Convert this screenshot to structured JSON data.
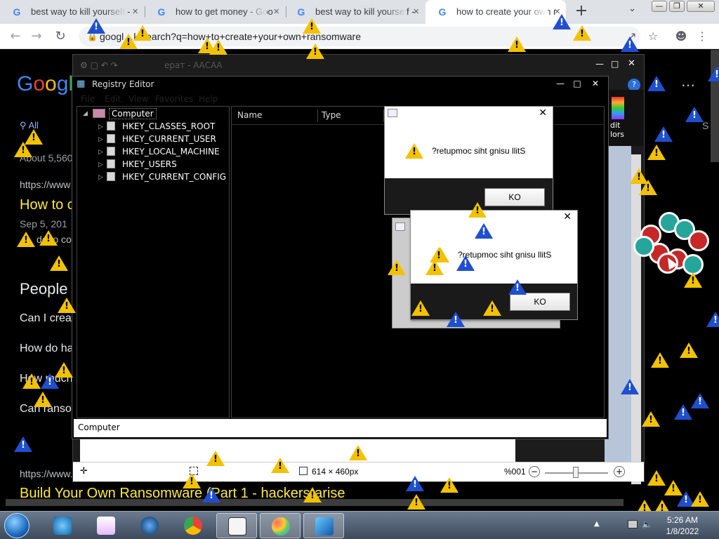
{
  "browser": {
    "tabs": [
      {
        "title": "best way to kill yourself -"
      },
      {
        "title": "how to get money - Goo"
      },
      {
        "title": "best way to kill yourself -"
      },
      {
        "title": "how to create your own r"
      }
    ],
    "address": "googl…k/search?q=how+to+create+your+own+ransomware"
  },
  "google_page": {
    "logo": "Googl",
    "tab_all": "All",
    "result_count": "About 5,560",
    "url_1": "https://www",
    "title_1": "How to c",
    "date_1": "Sep 5, 201",
    "snippet_1": "de to co",
    "people_also": "People",
    "q1": "Can I crea",
    "q2": "How do ha",
    "q3": "How much",
    "q4": "Can ranso",
    "url_2": "https://www.",
    "title_2": "Build Your Own Ransomware (Part 1 - hackers-arise"
  },
  "paint": {
    "title": "ерат - ААСАА",
    "dims": "614 × 460px",
    "zoom": "%001",
    "colors_label": "dit\nlors"
  },
  "regedit": {
    "title": "Registry Editor",
    "menus": [
      "File",
      "Edit",
      "View",
      "Favorites",
      "Help"
    ],
    "root": "Computer",
    "hives": [
      "HKEY_CLASSES_ROOT",
      "HKEY_CURRENT_USER",
      "HKEY_LOCAL_MACHINE",
      "HKEY_USERS",
      "HKEY_CURRENT_CONFIG"
    ],
    "columns": [
      "Name",
      "Type"
    ],
    "status": "Computer"
  },
  "dialogs": [
    {
      "message": "?retupmoc siht gnisu llitS",
      "button": "KO"
    },
    {
      "message": "?retupmoc siht gnisu llitS",
      "button": "KO"
    }
  ],
  "taskbar": {
    "time": "5:26 AM",
    "date": "1/8/2022"
  },
  "colors": {
    "warning": "#f2c200",
    "info": "#1f4fcf",
    "google_link": "#ffeb3b"
  }
}
